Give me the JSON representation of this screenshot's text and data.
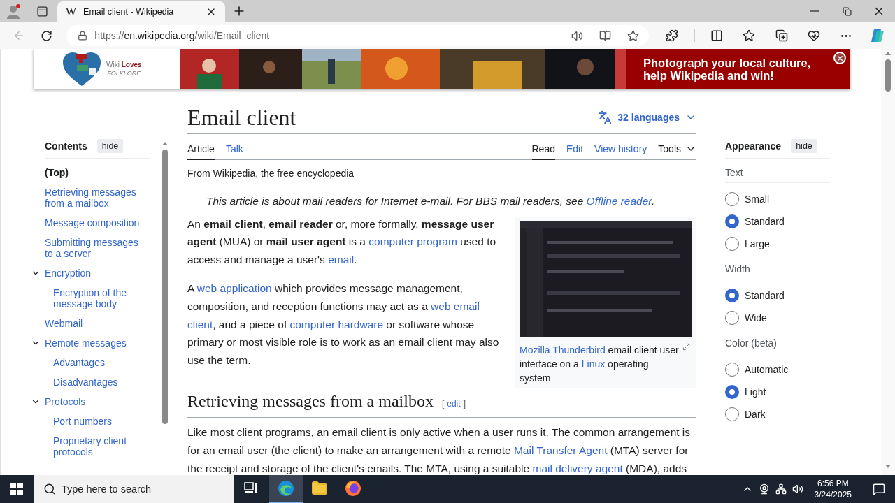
{
  "browser": {
    "favicon": "W",
    "tab_title": "Email client - Wikipedia",
    "url": {
      "scheme": "https://",
      "host": "en.wikipedia.org",
      "path": "/wiki/Email_client"
    }
  },
  "banner": {
    "logo_first": "Wiki",
    "logo_second": "Loves",
    "logo_subtitle": "FOLKLORE",
    "message": "Photograph your local culture, help Wikipedia and win!"
  },
  "toc": {
    "title": "Contents",
    "hide_button": "hide",
    "items": [
      {
        "label": "(Top)",
        "selected": true
      },
      {
        "label": "Retrieving messages from a mailbox",
        "selected": false
      },
      {
        "label": "Message composition",
        "selected": false
      },
      {
        "label": "Submitting messages to a server",
        "selected": false
      },
      {
        "label": "Encryption",
        "selected": false,
        "expanded": true,
        "children": [
          {
            "label": "Encryption of the message body",
            "selected": false
          }
        ]
      },
      {
        "label": "Webmail",
        "selected": false
      },
      {
        "label": "Remote messages",
        "selected": false,
        "expanded": true,
        "children": [
          {
            "label": "Advantages",
            "selected": false
          },
          {
            "label": "Disadvantages",
            "selected": false
          }
        ]
      },
      {
        "label": "Protocols",
        "selected": false,
        "expanded": true,
        "children": [
          {
            "label": "Port numbers",
            "selected": false
          },
          {
            "label": "Proprietary client protocols",
            "selected": false
          }
        ]
      }
    ]
  },
  "article": {
    "title": "Email client",
    "languages": "32 languages",
    "tabs_left": [
      {
        "label": "Article",
        "selected": true
      },
      {
        "label": "Talk",
        "selected": false
      }
    ],
    "tabs_right": [
      {
        "label": "Read",
        "selected": true
      },
      {
        "label": "Edit",
        "selected": false
      },
      {
        "label": "View history",
        "selected": false
      }
    ],
    "tools": "Tools",
    "tagline": "From Wikipedia, the free encyclopedia",
    "hatnote": [
      "This article is about mail readers for Internet e-mail. For BBS mail readers, see ",
      {
        "link": "Offline reader"
      },
      "."
    ],
    "figure": {
      "caption": [
        {
          "link": "Mozilla Thunderbird"
        },
        " email client user interface on a ",
        {
          "link": "Linux"
        },
        " operating system"
      ]
    },
    "paragraphs": [
      [
        "An **email client**, **email reader** or, more formally, **message user agent** (MUA) or **mail user agent** is a ",
        {
          "link": "computer program"
        },
        " used to access and manage a user's ",
        {
          "link": "email"
        },
        "."
      ],
      [
        "A ",
        {
          "link": "web application"
        },
        " which provides message management, composition, and reception functions may act as a ",
        {
          "link": "web email"
        },
        {
          "link": "client"
        },
        ", and a piece of ",
        {
          "link": "computer hardware"
        },
        " or software whose primary or most visible role is to work as an email client may also use the term."
      ]
    ],
    "sections": [
      {
        "heading": "Retrieving messages from a mailbox",
        "edit": {
          "open": "[",
          "label": "edit",
          "close": "]"
        },
        "paragraphs": [
          [
            "Like most client programs, an email client is only active when a user runs it. The common arrangement is for an email user (the client) to make an arrangement with a remote ",
            {
              "link": "Mail Transfer Agent"
            },
            " (MTA) server for the receipt and storage of the client's emails. The MTA, using a suitable ",
            {
              "link": "mail delivery agent"
            },
            " (MDA), adds"
          ]
        ]
      }
    ]
  },
  "appearance": {
    "title": "Appearance",
    "hide_button": "hide",
    "groups": [
      {
        "label": "Text",
        "options": [
          {
            "label": "Small",
            "selected": false
          },
          {
            "label": "Standard",
            "selected": true
          },
          {
            "label": "Large",
            "selected": false
          }
        ]
      },
      {
        "label": "Width",
        "options": [
          {
            "label": "Standard",
            "selected": true
          },
          {
            "label": "Wide",
            "selected": false
          }
        ]
      },
      {
        "label": "Color (beta)",
        "options": [
          {
            "label": "Automatic",
            "selected": false
          },
          {
            "label": "Light",
            "selected": true
          },
          {
            "label": "Dark",
            "selected": false
          }
        ]
      }
    ]
  },
  "taskbar": {
    "search_placeholder": "Type here to search",
    "apps": [
      {
        "kind": "taskview",
        "active": false
      },
      {
        "kind": "edge",
        "active": true
      },
      {
        "kind": "explorer",
        "active": false
      },
      {
        "kind": "firefox",
        "active": false
      }
    ],
    "time": "6:56 PM",
    "date": "3/24/2025"
  }
}
